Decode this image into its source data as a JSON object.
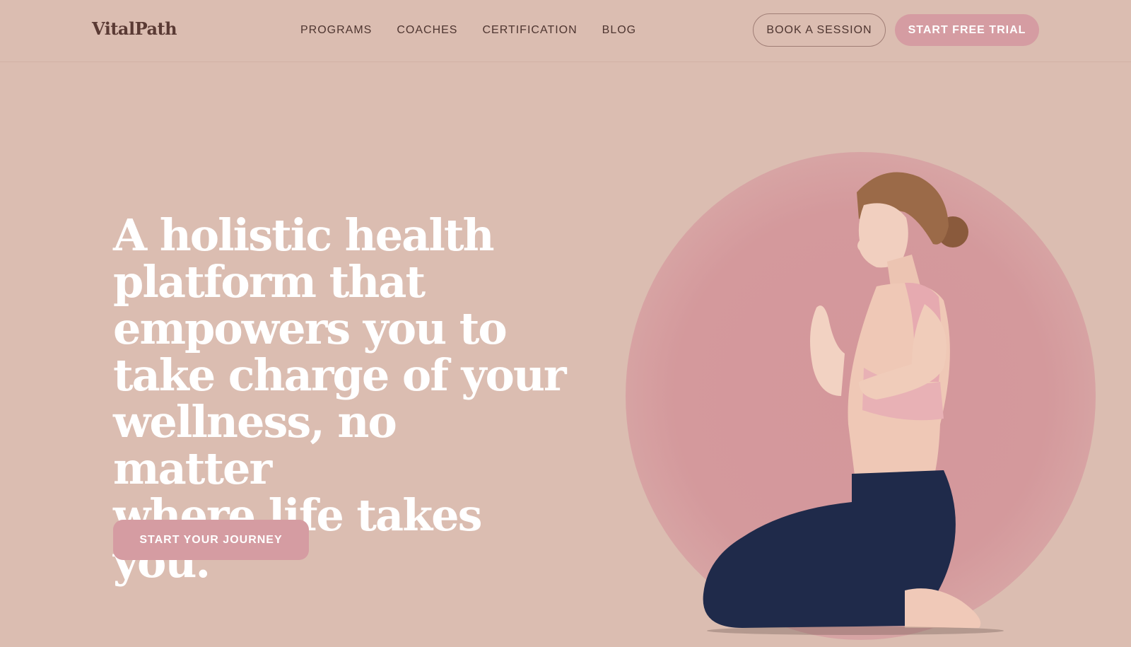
{
  "header": {
    "logo": "VitalPath",
    "nav": [
      "PROGRAMS",
      "COACHES",
      "CERTIFICATION",
      "BLOG"
    ],
    "book_session": "BOOK A SESSION",
    "free_trial": "START FREE TRIAL"
  },
  "hero": {
    "lines": [
      "A holistic health",
      "platform that",
      "empowers you to",
      "take charge of your",
      "wellness, no matter",
      "where life takes you."
    ],
    "cta": "START YOUR JOURNEY"
  },
  "colors": {
    "background": "#dbbdb1",
    "accent": "#d59ca2",
    "text_dark": "#4e3530",
    "circle": "#d4979b"
  },
  "icons": [
    "meditating-woman-image"
  ]
}
